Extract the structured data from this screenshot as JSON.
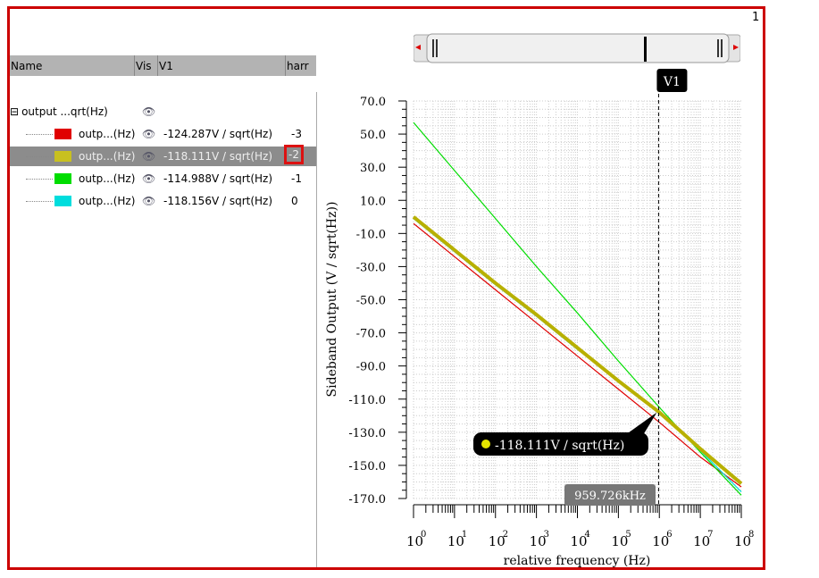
{
  "page_number": "1",
  "table": {
    "columns": [
      "Name",
      "Vis",
      "V1",
      "harr"
    ],
    "group": {
      "label": "output ...qrt(Hz)"
    },
    "rows": [
      {
        "name": "outp...(Hz)",
        "color": "#e00000",
        "value": "-124.287V / sqrt(Hz)",
        "harm": "-3",
        "selected": false
      },
      {
        "name": "outp...(Hz)",
        "color": "#c8c020",
        "value": "-118.111V / sqrt(Hz)",
        "harm": "-2",
        "selected": true
      },
      {
        "name": "outp...(Hz)",
        "color": "#00dd00",
        "value": "-114.988V / sqrt(Hz)",
        "harm": "-1",
        "selected": false
      },
      {
        "name": "outp...(Hz)",
        "color": "#00dddd",
        "value": "-118.156V / sqrt(Hz)",
        "harm": "0",
        "selected": false
      }
    ]
  },
  "marker": {
    "name": "V1",
    "x_label": "959.726kHz",
    "readout": "-118.111V / sqrt(Hz)",
    "x": 959726
  },
  "chart_data": {
    "type": "line",
    "xlabel": "relative frequency (Hz)",
    "ylabel": "Sideband Output (V / sqrt(Hz))",
    "xscale": "log",
    "xlim": [
      1,
      100000000
    ],
    "ylim": [
      -170,
      70
    ],
    "yticks": [
      "70.0",
      "50.0",
      "30.0",
      "10.0",
      "-10.0",
      "-30.0",
      "-50.0",
      "-70.0",
      "-90.0",
      "-110.0",
      "-130.0",
      "-150.0",
      "-170.0"
    ],
    "xticks": [
      "0",
      "1",
      "2",
      "3",
      "4",
      "5",
      "6",
      "7",
      "8"
    ],
    "grid": true,
    "x": [
      1,
      10,
      100,
      1000,
      10000,
      100000,
      1000000,
      10000000,
      100000000
    ],
    "series": [
      {
        "color": "#e00000",
        "values": [
          -4,
          -24,
          -44,
          -64,
          -84,
          -104,
          -124,
          -145,
          -163
        ]
      },
      {
        "color": "#00dddd",
        "values": [
          -1,
          -21,
          -41,
          -60,
          -80,
          -99,
          -118,
          -141,
          -166
        ]
      },
      {
        "color": "#00dd00",
        "values": [
          57,
          28,
          -1,
          -30,
          -58,
          -87,
          -115,
          -142,
          -168
        ]
      },
      {
        "color": "#b8b000",
        "values": [
          0,
          -20,
          -40,
          -59,
          -79,
          -99,
          -118,
          -140,
          -161
        ]
      }
    ]
  }
}
